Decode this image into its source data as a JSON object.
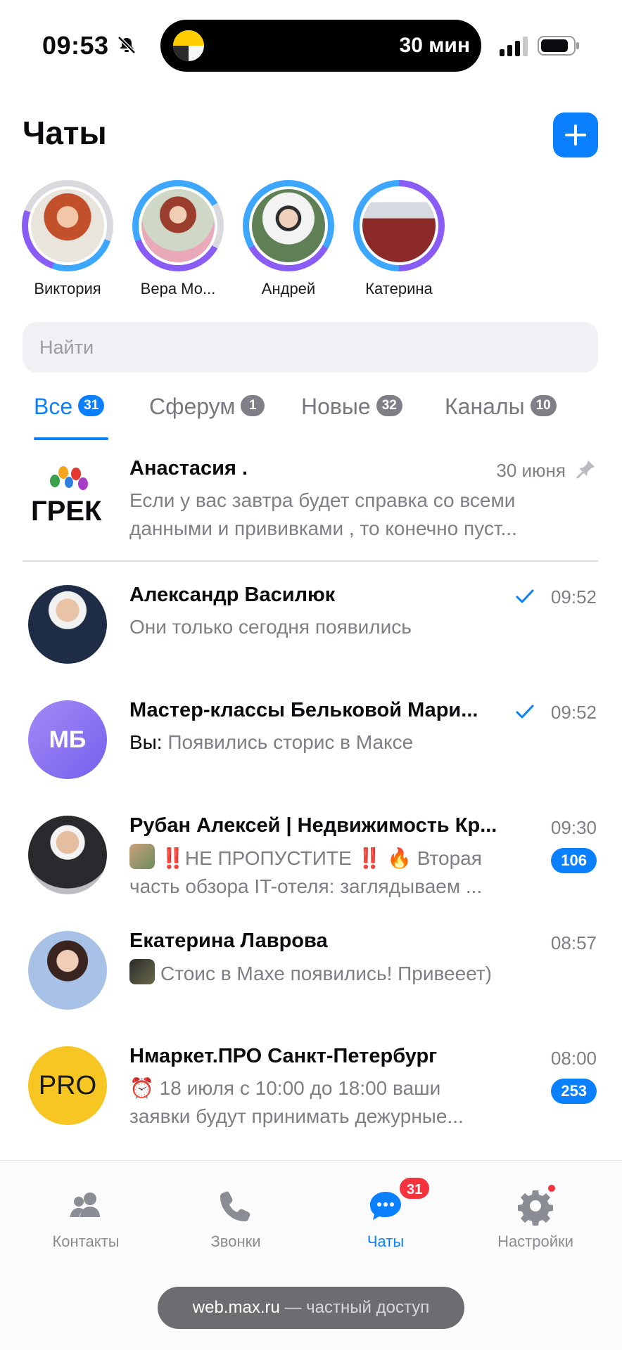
{
  "status_bar": {
    "time": "09:53",
    "island_text": "30 мин"
  },
  "header": {
    "title": "Чаты",
    "new_chat_icon": "plus-icon"
  },
  "stories": [
    {
      "name": "Виктория"
    },
    {
      "name": "Вера Мо..."
    },
    {
      "name": "Андрей"
    },
    {
      "name": "Катерина"
    }
  ],
  "search": {
    "placeholder": "Найти"
  },
  "tabs": [
    {
      "label": "Все",
      "count": "31",
      "active": true
    },
    {
      "label": "Сферум",
      "count": "1"
    },
    {
      "label": "Новые",
      "count": "32"
    },
    {
      "label": "Каналы",
      "count": "10"
    }
  ],
  "chats": [
    {
      "name": "Анастасия .",
      "time": "30 июня",
      "pinned": true,
      "preview": "Если у вас завтра будет справка со всеми данными и прививками , то конечно пуст..."
    },
    {
      "name": "Александр Василюк",
      "time": "09:52",
      "read_check": true,
      "preview": "Они только сегодня появились"
    },
    {
      "name": "Мастер-классы Бельковой Мари...",
      "time": "09:52",
      "read_check": true,
      "avatar_initials": "МБ",
      "sender": "Вы:",
      "preview": "Появились сторис в Максе"
    },
    {
      "name": "Рубан Алексей | Недвижимость Кр...",
      "time": "09:30",
      "unread": "106",
      "preview_line1": "‼️НЕ ПРОПУСТИТЕ ‼️ 🔥 Вторая",
      "preview_line2": "часть обзора IT-отеля: заглядываем ..."
    },
    {
      "name": "Екатерина Лаврова",
      "time": "08:57",
      "preview": "Стоис в Махе появились! Привееет)"
    },
    {
      "name": "Нмаркет.ПРО Санкт-Петербург",
      "time": "08:00",
      "unread": "253",
      "avatar_initials": "PRO",
      "preview_line1": "⏰ 18 июля с 10:00 до 18:00 ваши",
      "preview_line2": "заявки будут принимать дежурные..."
    }
  ],
  "bottom_nav": [
    {
      "label": "Контакты",
      "icon": "contacts-icon"
    },
    {
      "label": "Звонки",
      "icon": "phone-icon"
    },
    {
      "label": "Чаты",
      "icon": "chat-icon",
      "badge": "31",
      "active": true
    },
    {
      "label": "Настройки",
      "icon": "gear-icon"
    }
  ],
  "url_bar": {
    "host": "web.max.ru",
    "suffix": "— частный доступ"
  },
  "colors": {
    "accent": "#0b80ff",
    "badge_red": "#f5333f",
    "pro_yellow": "#f7c623",
    "mb_purple": "#8b6cf5"
  }
}
